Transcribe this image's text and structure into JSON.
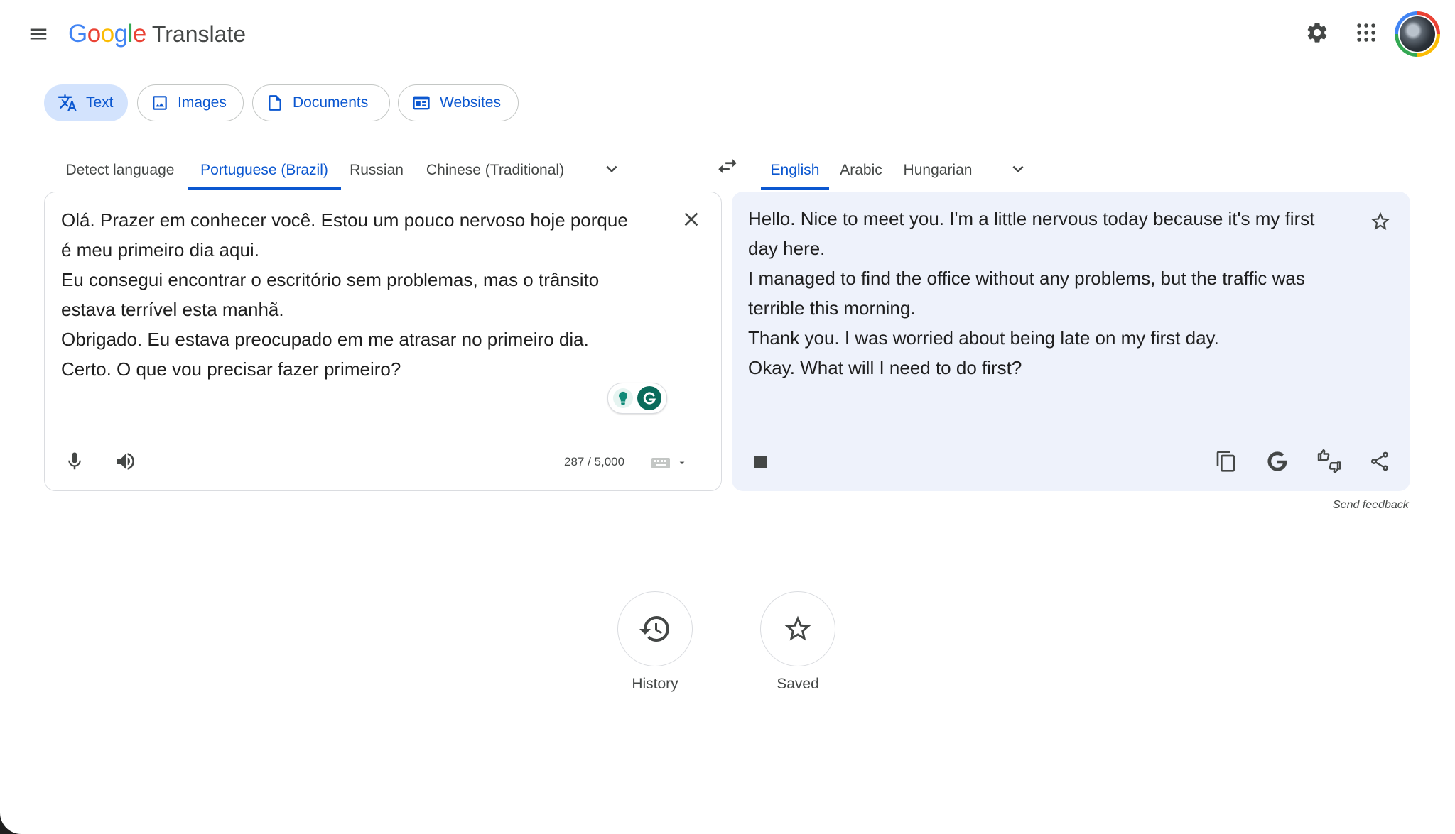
{
  "header": {
    "logo_google": "Google",
    "logo_translate": "Translate",
    "icons": [
      "menu-icon",
      "settings-icon",
      "apps-icon",
      "account-avatar"
    ]
  },
  "modes": {
    "text": "Text",
    "images": "Images",
    "documents": "Documents",
    "websites": "Websites",
    "selected": "Text"
  },
  "source_languages": {
    "detect": "Detect language",
    "portuguese": "Portuguese (Brazil)",
    "russian": "Russian",
    "chinese": "Chinese (Traditional)",
    "selected": "Portuguese (Brazil)"
  },
  "target_languages": {
    "english": "English",
    "arabic": "Arabic",
    "hungarian": "Hungarian",
    "selected": "English"
  },
  "source": {
    "text": "Olá. Prazer em conhecer você. Estou um pouco nervoso hoje porque\né meu primeiro dia aqui.\nEu consegui encontrar o escritório sem problemas, mas o trânsito\nestava terrível esta manhã.\nObrigado. Eu estava preocupado em me atrasar no primeiro dia.\nCerto. O que vou precisar fazer primeiro?",
    "char_count": "287 / 5,000"
  },
  "target": {
    "text": "Hello. Nice to meet you. I'm a little nervous today because it's my first\nday here.\nI managed to find the office without any problems, but the traffic was\nterrible this morning.\nThank you. I was worried about being late on my first day.\nOkay. What will I need to do first?"
  },
  "feedback_link": "Send feedback",
  "bottom": {
    "history": "History",
    "saved": "Saved"
  },
  "colors": {
    "accent": "#0b57d0",
    "accent_bg": "#d3e3fd",
    "target_panel_bg": "#eef2fb"
  }
}
